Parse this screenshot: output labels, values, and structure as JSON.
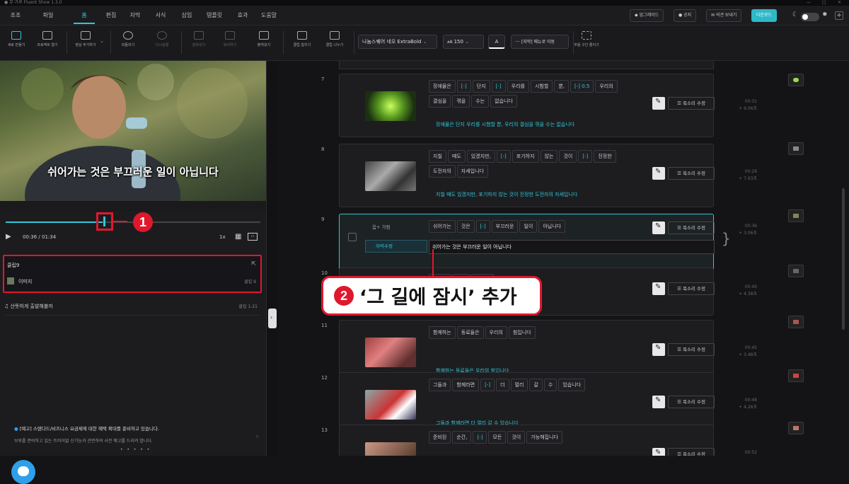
{
  "window": {
    "title": "● 뮤·가루 Fluent Show 1.3.0",
    "minimize": "—",
    "maximize": "□",
    "close": "✕"
  },
  "menu": {
    "items": [
      "조조",
      "파일",
      "홈",
      "편집",
      "자막",
      "서식",
      "삽입",
      "템플릿",
      "효과",
      "도움말"
    ],
    "active_index": 2
  },
  "header_buttons": {
    "upgrade": "업그레이드",
    "notice": "공지",
    "feedback": "의견 보내기",
    "account": "다운로드"
  },
  "toolbar": {
    "new": "새로 만들기",
    "open": "프로젝트 열기",
    "add_video": "영상 추가하기",
    "undo": "되돌리기",
    "redo": "다시실행",
    "cut": "잘라내기",
    "copy": "복사하기",
    "paste": "붙여넣기",
    "merge": "클립 합치기",
    "split": "클립 나누기",
    "font": "나눔스퀘어 네오 ExtraBold",
    "font_size": "150",
    "font_color": "A",
    "subtitle_mode": "[자막] 메뉴로 이동",
    "silence": "무음 구간 줄이기"
  },
  "preview": {
    "subtitle": "쉬어가는 것은 부끄러운 일이 아닙니다",
    "time_current": "00:36",
    "time_total": "01:34",
    "speed": "1x",
    "progress": 0.38
  },
  "clip_panel": {
    "title": "클립9",
    "item_label": "이미지",
    "item_meta": "클립 9"
  },
  "music": {
    "title": "산뜻하게 출발해볼까",
    "meta": "클립 1-21"
  },
  "notice": {
    "title": "[예고] 스탠다드/비즈니스 요금제에 대한 혜택 확대를 준비하고 있습니다.",
    "body": "브루를 준비하고 있는 트러이없 신기능과 관련하여 사전 예고를 드리려 합니다."
  },
  "rows": [
    {
      "num": "7",
      "words": [
        "장애물은",
        "[-]",
        "단지",
        "[-]",
        "우리를",
        "시험할",
        "뿐,",
        "[-] 0.5",
        "우리의",
        "결심을",
        "꺾을",
        "수는",
        "없습니다"
      ],
      "sentence": "장애물은 단지 우리를 시험할 뿐, 우리의 결심을 꺾을 수는 없습니다",
      "time": "00:31",
      "len": "+ 6.06초"
    },
    {
      "num": "8",
      "words": [
        "지칠",
        "때도",
        "있겠지만,",
        "[-]",
        "포기하지",
        "않는",
        "것이",
        "[-]",
        "진정한",
        "도전자의",
        "자세입니다"
      ],
      "sentence": "지칠 때도 있겠지만, 포기하지 않는 것이 진정한 도전자의 자세입니다",
      "time": "00:29",
      "len": "+ 7.63초"
    },
    {
      "num": "9",
      "words": [
        "쉬어가는",
        "것은",
        "[-]",
        "부끄러운",
        "일이",
        "아닙니다"
      ],
      "sentence": "쉬어가는 것은 부끄러운 일이 아닙니다",
      "tag": "음+ 가림",
      "sub_label": "자막수정",
      "time": "00:36",
      "len": "+ 3.06초"
    },
    {
      "num": "10",
      "words": [
        "준비된",
        "일이",
        "입니다"
      ],
      "sentence": "",
      "time": "00:40",
      "len": "+ 4.38초"
    },
    {
      "num": "11",
      "words": [
        "함께하는",
        "동료들은",
        "우리의",
        "힘입니다"
      ],
      "sentence": "함께하는 동료들은 우리의 힘입니다",
      "time": "00:45",
      "len": "+ 3.48초"
    },
    {
      "num": "12",
      "words": [
        "그들과",
        "함께라면",
        "[-]",
        "더",
        "멀리",
        "갈",
        "수",
        "있습니다"
      ],
      "sentence": "그들과 함께라면 더 멀리 갈 수 있습니다",
      "time": "00:48",
      "len": "+ 4.26초"
    },
    {
      "num": "13",
      "words": [
        "준비된",
        "순간,",
        "[-]",
        "모든",
        "것이",
        "가능해집니다"
      ],
      "sentence": "",
      "time": "00:52",
      "len": "+ 4.02초"
    }
  ],
  "voice_btn_label": "목소리 수정",
  "callouts": {
    "one": "1",
    "two": "2",
    "two_text": "‘그 길에 잠시’ 추가"
  },
  "colors": {
    "accent": "#2fc8d8",
    "callout_red": "#e0182d"
  }
}
